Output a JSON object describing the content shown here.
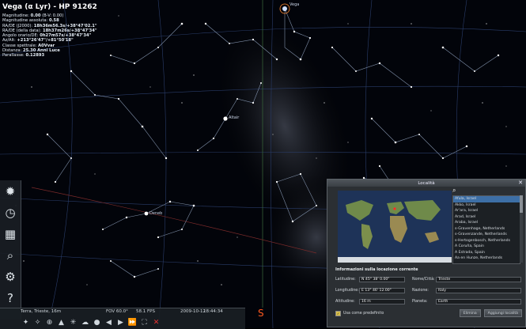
{
  "object_info": {
    "title": "Vega (α Lyr) - HP 91262",
    "lines": [
      {
        "label": "Magnitudine:",
        "value": "0.00",
        "extra": "(B-V: 0.00)"
      },
      {
        "label": "Magnitudine assoluta:",
        "value": "0.58",
        "extra": ""
      },
      {
        "label": "RA/DE (J2000):",
        "value": "18h36m56.3s/+38°47'02.1\"",
        "extra": ""
      },
      {
        "label": "RA/DE (della data):",
        "value": "18h37m26s/+38°47'34\"",
        "extra": ""
      },
      {
        "label": "Angolo orario/DE:",
        "value": "0h27m57s/+38°47'34\"",
        "extra": ""
      },
      {
        "label": "Az/Alt:",
        "value": "+213°26'47\"/+81°50'18\"",
        "extra": ""
      },
      {
        "label": "Classe spettrale:",
        "value": "A0Vvar",
        "extra": ""
      },
      {
        "label": "Distanza:",
        "value": "25.30 Anni Luce",
        "extra": ""
      },
      {
        "label": "Parallasse:",
        "value": "0.12893",
        "extra": ""
      }
    ]
  },
  "sky_labels": {
    "vega": "Vega",
    "altair": "Altair",
    "deneb": "Deneb",
    "compass_south": "S"
  },
  "sidebar": [
    {
      "icon": "sky-icon",
      "glyph": "✹"
    },
    {
      "icon": "clock-icon",
      "glyph": "◷"
    },
    {
      "icon": "display-options-icon",
      "glyph": "▦"
    },
    {
      "icon": "search-icon",
      "glyph": "⌕"
    },
    {
      "icon": "settings-icon",
      "glyph": "⚙"
    },
    {
      "icon": "help-icon",
      "glyph": "?"
    }
  ],
  "bottom_bar": {
    "location": "Terra, Trieste, 16m",
    "fov": "FOV 60.0°",
    "fps": "58.1 FPS",
    "date": "2009-10-12",
    "time": "18:44:34",
    "tools": [
      {
        "icon": "constellation-lines-icon",
        "glyph": "✦"
      },
      {
        "icon": "constellation-labels-icon",
        "glyph": "✧"
      },
      {
        "icon": "grid-icon",
        "glyph": "⊕"
      },
      {
        "icon": "landscape-icon",
        "glyph": "▲"
      },
      {
        "icon": "nebula-icon",
        "glyph": "✳"
      },
      {
        "icon": "atmosphere-icon",
        "glyph": "☁"
      },
      {
        "icon": "planets-icon",
        "glyph": "●"
      },
      {
        "icon": "rewind-icon",
        "glyph": "◀"
      },
      {
        "icon": "play-icon",
        "glyph": "▶"
      },
      {
        "icon": "forward-icon",
        "glyph": "⏩"
      },
      {
        "icon": "fullscreen-icon",
        "glyph": "⛶"
      },
      {
        "icon": "quit-icon",
        "glyph": "✕"
      }
    ]
  },
  "location_dialog": {
    "title": "Località",
    "search_placeholder": "",
    "list": [
      "Afula, Israel",
      "Akko, Israel",
      "Ar'ara, Israel",
      "Arad, Israel",
      "Araba, Israel",
      "s-Gravenhage, Netherlands",
      "s-Gravenzande, Netherlands",
      "s-Hertogenbosch, Netherlands",
      "A Coruña, Spain",
      "A Estrada, Spain",
      "Aa en Hunze, Netherlands"
    ],
    "section_title": "Informazioni sulla locazione corrente",
    "latitude_label": "Latitudine:",
    "latitude_value": "N 45° 38' 0.00\"",
    "longitude_label": "Longitudine:",
    "longitude_value": "E 13° 46' 12.00\"",
    "altitude_label": "Altitudine:",
    "altitude_value": "16 m",
    "name_label": "Nome/Città:",
    "name_value": "Trieste",
    "country_label": "Nazione:",
    "country_value": "Italy",
    "planet_label": "Pianeta:",
    "planet_value": "Earth",
    "default_label": "Usa come predefinito",
    "delete_button": "Elimina",
    "add_button": "Aggiungi località",
    "close_glyph": "✕"
  },
  "colors": {
    "accent_red": "#e33333",
    "compass_orange": "#ff5a1f",
    "list_selected": "#3d6fa6"
  }
}
